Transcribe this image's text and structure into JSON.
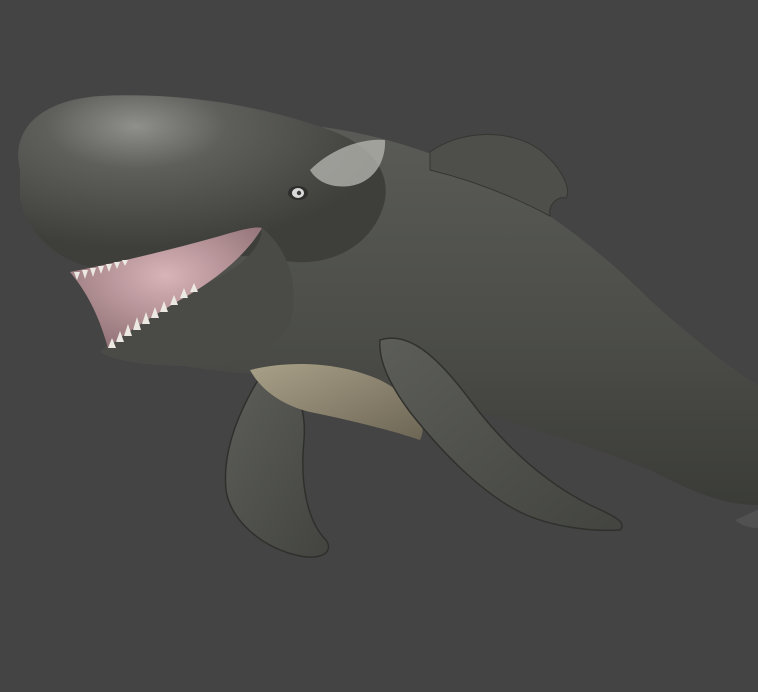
{
  "scene": {
    "subject": "whale-3d-model",
    "background_color": "#444444",
    "body_color": "#4f504c",
    "body_highlight": "#8a8b86",
    "belly_color": "#9a9077",
    "mouth_color": "#c9a4a8",
    "teeth_color": "#e9e6df",
    "eye_color": "#d8d8d8"
  }
}
